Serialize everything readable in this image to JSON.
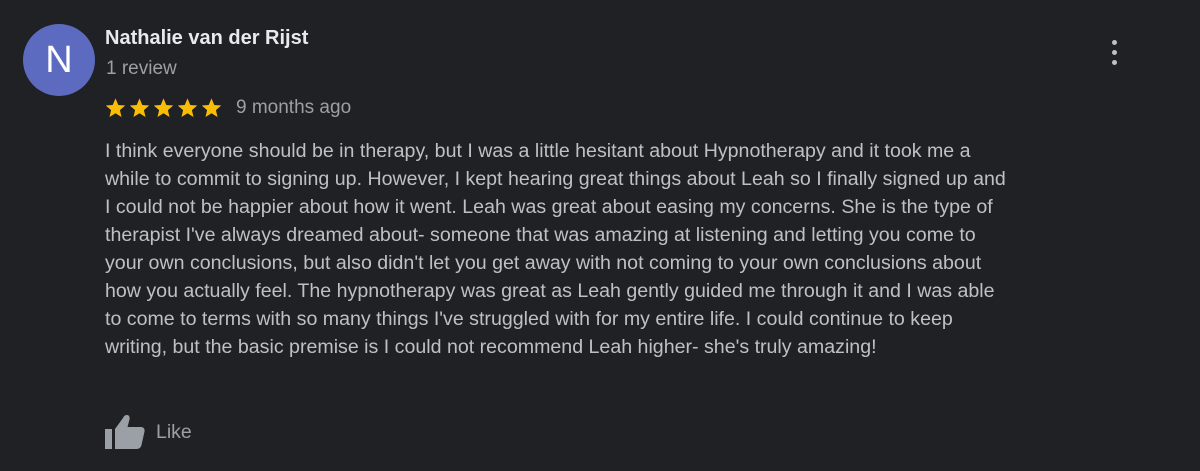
{
  "review": {
    "avatar_initial": "N",
    "author_name": "Nathalie van der Rijst",
    "review_count": "1 review",
    "rating": 5,
    "rating_max": 5,
    "timestamp": "9 months ago",
    "lines": [
      "I think everyone should be in therapy, but I was a little hesitant about Hypnotherapy and it took me a",
      "while to commit to signing up. However, I kept hearing great things about Leah so I finally signed up and",
      "I could not be happier about how it went. Leah was great about easing my concerns. She is the type of",
      "therapist I've always dreamed about- someone that was amazing at listening and letting you come to",
      "your own conclusions, but also didn't let you get away with not coming to your own conclusions about",
      "how you actually feel. The hypnotherapy was great as Leah gently guided me through it and I was able",
      "to come to terms with so many things I've struggled with for my entire life. I could continue to keep",
      "writing, but the basic premise is I could not recommend Leah higher- she's truly amazing!"
    ],
    "like_label": "Like"
  },
  "colors": {
    "background": "#202124",
    "avatar": "#5c6bc0",
    "star": "#fbbc04",
    "name": "#e8eaed",
    "body_text": "#bdc1c6",
    "secondary_text": "#9aa0a6"
  },
  "icons": {
    "menu": "more-vertical-icon",
    "star": "star-icon",
    "like": "thumbs-up-icon"
  }
}
